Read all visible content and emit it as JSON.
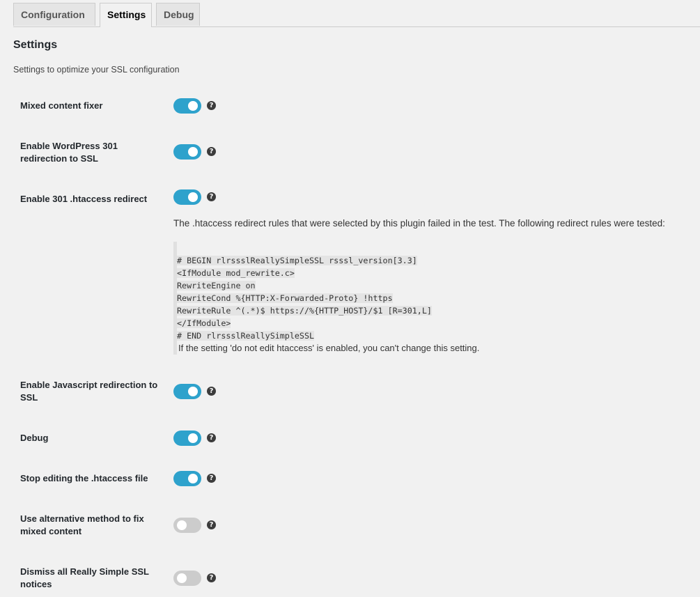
{
  "tabs": [
    {
      "label": "Configuration",
      "active": false
    },
    {
      "label": "Settings",
      "active": true
    },
    {
      "label": "Debug",
      "active": false
    }
  ],
  "page": {
    "title": "Settings",
    "description": "Settings to optimize your SSL configuration"
  },
  "help_glyph": "?",
  "settings": [
    {
      "label": "Mixed content fixer",
      "enabled": true
    },
    {
      "label": "Enable WordPress 301 redirection to SSL",
      "enabled": true
    },
    {
      "label": "Enable 301 .htaccess redirect",
      "enabled": true
    },
    {
      "label": "Enable Javascript redirection to SSL",
      "enabled": true
    },
    {
      "label": "Debug",
      "enabled": true
    },
    {
      "label": "Stop editing the .htaccess file",
      "enabled": true
    },
    {
      "label": "Use alternative method to fix mixed content",
      "enabled": false
    },
    {
      "label": "Dismiss all Really Simple SSL notices",
      "enabled": false
    }
  ],
  "htaccess": {
    "note": "The .htaccess redirect rules that were selected by this plugin failed in the test. The following redirect rules were tested:",
    "code": [
      "# BEGIN rlrssslReallySimpleSSL rsssl_version[3.3]",
      "<IfModule mod_rewrite.c>",
      "RewriteEngine on",
      "RewriteCond %{HTTP:X-Forwarded-Proto} !https",
      "RewriteRule ^(.*)$ https://%{HTTP_HOST}/$1 [R=301,L]",
      "</IfModule>",
      "# END rlrssslReallySimpleSSL"
    ],
    "footer": "If the setting 'do not edit htaccess' is enabled, you can't change this setting."
  },
  "colors": {
    "toggle_on": "#2ea2cc",
    "toggle_off": "#cccccc",
    "background": "#f1f1f1"
  }
}
